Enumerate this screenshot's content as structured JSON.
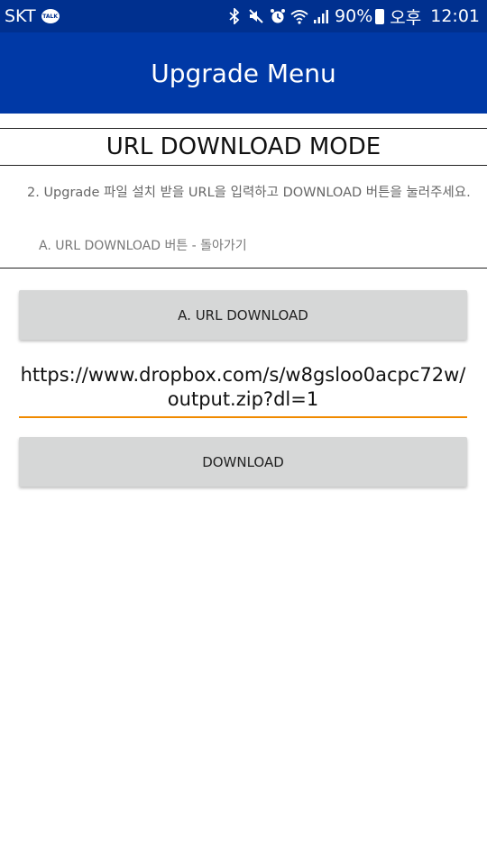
{
  "status_bar": {
    "carrier": "SKT",
    "talk_badge": "TALK",
    "battery": "90%",
    "ampm": "오후",
    "time": "12:01"
  },
  "app_bar": {
    "title": "Upgrade Menu"
  },
  "main": {
    "mode_title": "URL DOWNLOAD MODE",
    "instruction": "2. Upgrade 파일 설치 받을 URL을 입력하고 DOWNLOAD 버튼을 눌러주세요.",
    "hint": "A. URL DOWNLOAD 버튼 - 돌아가기",
    "url_download_button": "A. URL DOWNLOAD",
    "url_value": "https://www.dropbox.com/s/w8gsloo0acpc72w/output.zip?dl=1",
    "download_button": "DOWNLOAD"
  },
  "colors": {
    "status_bar_bg": "#00308f",
    "app_bar_bg": "#0039a6",
    "button_bg": "#d6d7d7",
    "input_underline": "#f08a00"
  }
}
